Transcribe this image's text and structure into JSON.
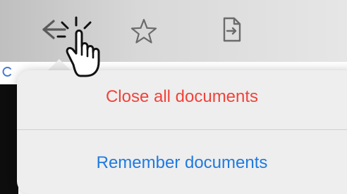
{
  "toolbar": {
    "icons": [
      {
        "name": "back-arrow-icon"
      },
      {
        "name": "star-icon"
      },
      {
        "name": "export-document-icon"
      }
    ]
  },
  "menu": {
    "items": [
      {
        "label": "Close all documents",
        "color": "#f0433a"
      },
      {
        "label": "Remember documents",
        "color": "#1f7ae0"
      }
    ]
  },
  "overlay": {
    "cursor": "hand-tap-icon"
  }
}
